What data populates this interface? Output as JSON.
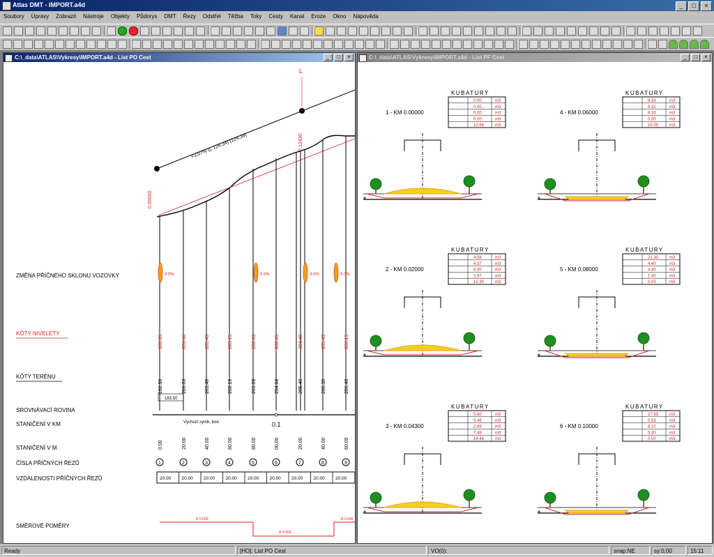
{
  "app": {
    "title": "Atlas DMT - IMPORT.a4d",
    "minimize": "_",
    "maximize": "□",
    "close": "×"
  },
  "menu": [
    "Soubory",
    "Úpravy",
    "Zobrazit",
    "Nástroje",
    "Objekty",
    "Půdorys",
    "DMT",
    "Řezy",
    "Odstřel",
    "Těžba",
    "Toky",
    "Cesty",
    "Kanal",
    "Eroze",
    "Okno",
    "Nápověda"
  ],
  "left_window": {
    "title": "C:\\_data\\ATLAS\\Vykresy\\IMPORT.a4d - List PO Cest",
    "profile": {
      "slope_label": "+3,07% (L 124,34) (124,34)",
      "label_zmena": "ZMĚNA PŘÍČNÉHO SKLONU VOZOVKY",
      "label_nivelety": "KÓTY NIVELETY",
      "label_terenu": "KÓTY TERÉNU",
      "label_srovnavaci": "SROVNÁVACÍ ROVINA",
      "label_staniceni_km": "STANIČENÍ V KM",
      "label_staniceni_m": "STANIČENÍ V M",
      "label_cisla": "ČÍSLA PŘÍČNÝCH ŘEZŮ",
      "label_vzdalenosti": "VZDÁLENOSTI PŘÍČNÝCH ŘEZŮ",
      "label_smerove": "SMĚROVÉ POMĚRY",
      "top_marker": "L",
      "start_station_label": "0.00000",
      "mid_station_label": "0.12430",
      "srovnavaci_value": "183.50",
      "vychozi_label": "Výchozí symb. bod",
      "km_label": "0.1",
      "sklon_values": [
        "3.0%",
        "3.0%",
        "3.0%",
        "3.0%"
      ],
      "nivelety": [
        "183.05",
        "203.46",
        "205.43",
        "205.15",
        "202.03",
        "202.85",
        "204.40",
        "205.43",
        "206.15"
      ],
      "terenu": [
        "192.98",
        "200.03",
        "203.48",
        "202.19",
        "203.09",
        "204.84",
        "205.40",
        "206.30",
        "206.40"
      ],
      "staniceni_m": [
        "0.00",
        "20.00",
        "40.00",
        "60.00",
        "80.00",
        "00.00",
        "20.00",
        "40.00",
        "60.00"
      ],
      "cisla": [
        "1",
        "2",
        "3",
        "4",
        "5",
        "6",
        "7",
        "8",
        "9"
      ],
      "vzdalenosti": [
        "20.00",
        "20.00",
        "20.00",
        "20.00",
        "20.00",
        "20.00",
        "20.00",
        "20.00",
        "20.00"
      ],
      "smer_left": "R 0.000",
      "smer_mid": "R 0.000",
      "smer_right": "R 0.000"
    }
  },
  "right_window": {
    "title": "C:\\_data\\ATLAS\\Vykresy\\IMPORT.a4d - List PF Cest",
    "kubatury_title": "KUBATURY",
    "unit": "m3",
    "sections": [
      {
        "label": "1 - KM 0.00000",
        "rows": [
          "0.00",
          "0.00",
          "0.00",
          "0.00",
          "10.56"
        ]
      },
      {
        "label": "2 - KM 0.02000",
        "rows": [
          "4.56",
          "4.37",
          "8.30",
          "2.97",
          "12.30"
        ]
      },
      {
        "label": "3 - KM 0.04300",
        "rows": [
          "5.60",
          "5.46",
          "2.66",
          "7.48",
          "14.46"
        ]
      },
      {
        "label": "4 - KM 0.06000",
        "rows": [
          "9.33",
          "9.32",
          "9.33",
          "0.00",
          "10.00"
        ]
      },
      {
        "label": "5 - KM 0.08000",
        "rows": [
          "21.30",
          "4.40",
          "4.40",
          "1.40",
          "0.00"
        ]
      },
      {
        "label": "6 - KM 0.10000",
        "rows": [
          "27.93",
          "0.53",
          "8.10",
          "5.30",
          "0.00"
        ]
      }
    ]
  },
  "status": {
    "ready": "Ready",
    "list": "[HO]: List PO Cest",
    "vo": "VO(0):",
    "snap": "snap:NE",
    "coords": "sy:0,00",
    "time": "15:11"
  },
  "colors": {
    "red": "#d81e1e",
    "orange": "#f0a020",
    "yellow": "#f4d020",
    "tree": "#1f8f1f",
    "title_blue": "#0a246a"
  }
}
